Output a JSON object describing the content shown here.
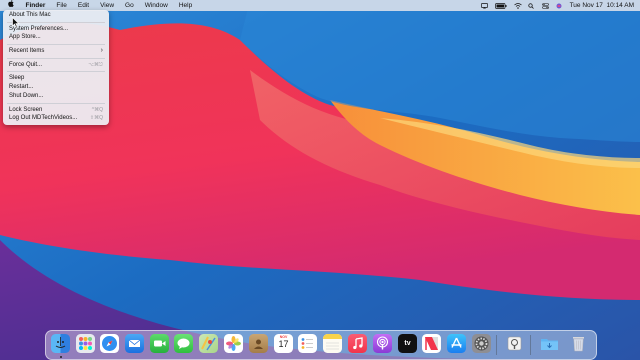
{
  "menubar": {
    "apple_icon": "apple-logo-icon",
    "items": [
      "Finder",
      "File",
      "Edit",
      "View",
      "Go",
      "Window",
      "Help"
    ],
    "clock": "Tue Nov 17  10:14 AM"
  },
  "apple_menu": {
    "items": {
      "about": "About This Mac",
      "sysprefs": "System Preferences...",
      "appstore": "App Store...",
      "recent": "Recent Items",
      "forcequit": "Force Quit...",
      "forcequit_sc": "⌥⌘⎋",
      "sleep": "Sleep",
      "restart": "Restart...",
      "shutdown": "Shut Down...",
      "lock": "Lock Screen",
      "lock_sc": "^⌘Q",
      "logout": "Log Out MDTechVideos...",
      "logout_sc": "⇧⌘Q"
    }
  },
  "dock": {
    "calendar_month": "NOV",
    "calendar_day": "17",
    "tv_label": "tv",
    "apps": [
      "finder",
      "launchpad",
      "safari",
      "mail",
      "facetime",
      "messages",
      "maps",
      "photos",
      "contacts",
      "calendar",
      "reminders",
      "notes",
      "music",
      "podcasts",
      "tv",
      "news",
      "app-store",
      "system-preferences",
      "preview",
      "downloads",
      "trash"
    ]
  },
  "colors": {
    "accent": "#3b82f6",
    "wallpaper_red": "#f23a5a",
    "wallpaper_blue": "#1f74c8",
    "wallpaper_orange": "#fbb03b"
  }
}
